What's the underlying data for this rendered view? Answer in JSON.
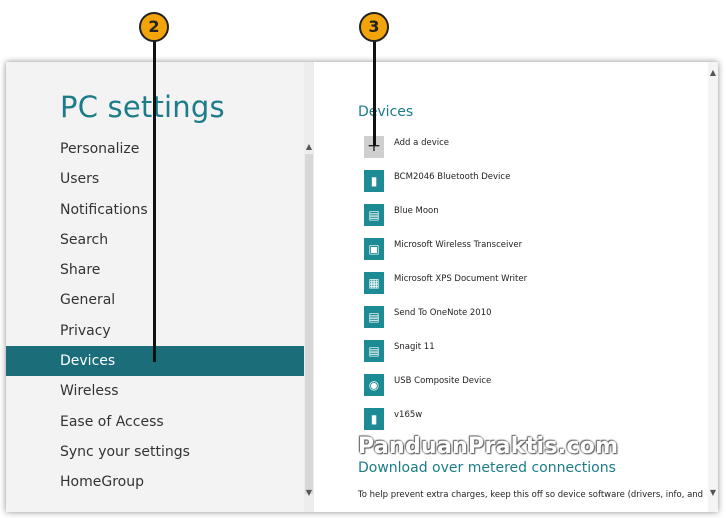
{
  "left": {
    "title": "PC settings",
    "items": [
      {
        "label": "Personalize"
      },
      {
        "label": "Users"
      },
      {
        "label": "Notifications"
      },
      {
        "label": "Search"
      },
      {
        "label": "Share"
      },
      {
        "label": "General"
      },
      {
        "label": "Privacy"
      },
      {
        "label": "Devices",
        "selected": true
      },
      {
        "label": "Wireless"
      },
      {
        "label": "Ease of Access"
      },
      {
        "label": "Sync your settings"
      },
      {
        "label": "HomeGroup"
      }
    ]
  },
  "right": {
    "section_title": "Devices",
    "add_device": {
      "label": "Add a device",
      "icon": "plus-icon"
    },
    "devices": [
      {
        "label": "BCM2046 Bluetooth Device",
        "icon": "usb-stick-icon"
      },
      {
        "label": "Blue Moon",
        "icon": "printer-icon"
      },
      {
        "label": "Microsoft Wireless Transceiver",
        "icon": "monitor-keyboard-icon"
      },
      {
        "label": "Microsoft XPS Document Writer",
        "icon": "document-icon"
      },
      {
        "label": "Send To OneNote 2010",
        "icon": "printer-icon"
      },
      {
        "label": "Snagit 11",
        "icon": "printer-icon"
      },
      {
        "label": "USB Composite Device",
        "icon": "webcam-icon"
      },
      {
        "label": "v165w",
        "icon": "usb-stick-icon"
      }
    ],
    "metered_title": "Download over metered connections",
    "metered_desc": "To help prevent extra charges, keep this off so device software (drivers, info, and"
  },
  "watermark": "PanduanPraktis.com",
  "callouts": {
    "first": "2",
    "second": "3"
  },
  "colors": {
    "accent": "#1c7c8a",
    "selected_bg": "#1b6e79",
    "callout": "#f2a40a"
  }
}
